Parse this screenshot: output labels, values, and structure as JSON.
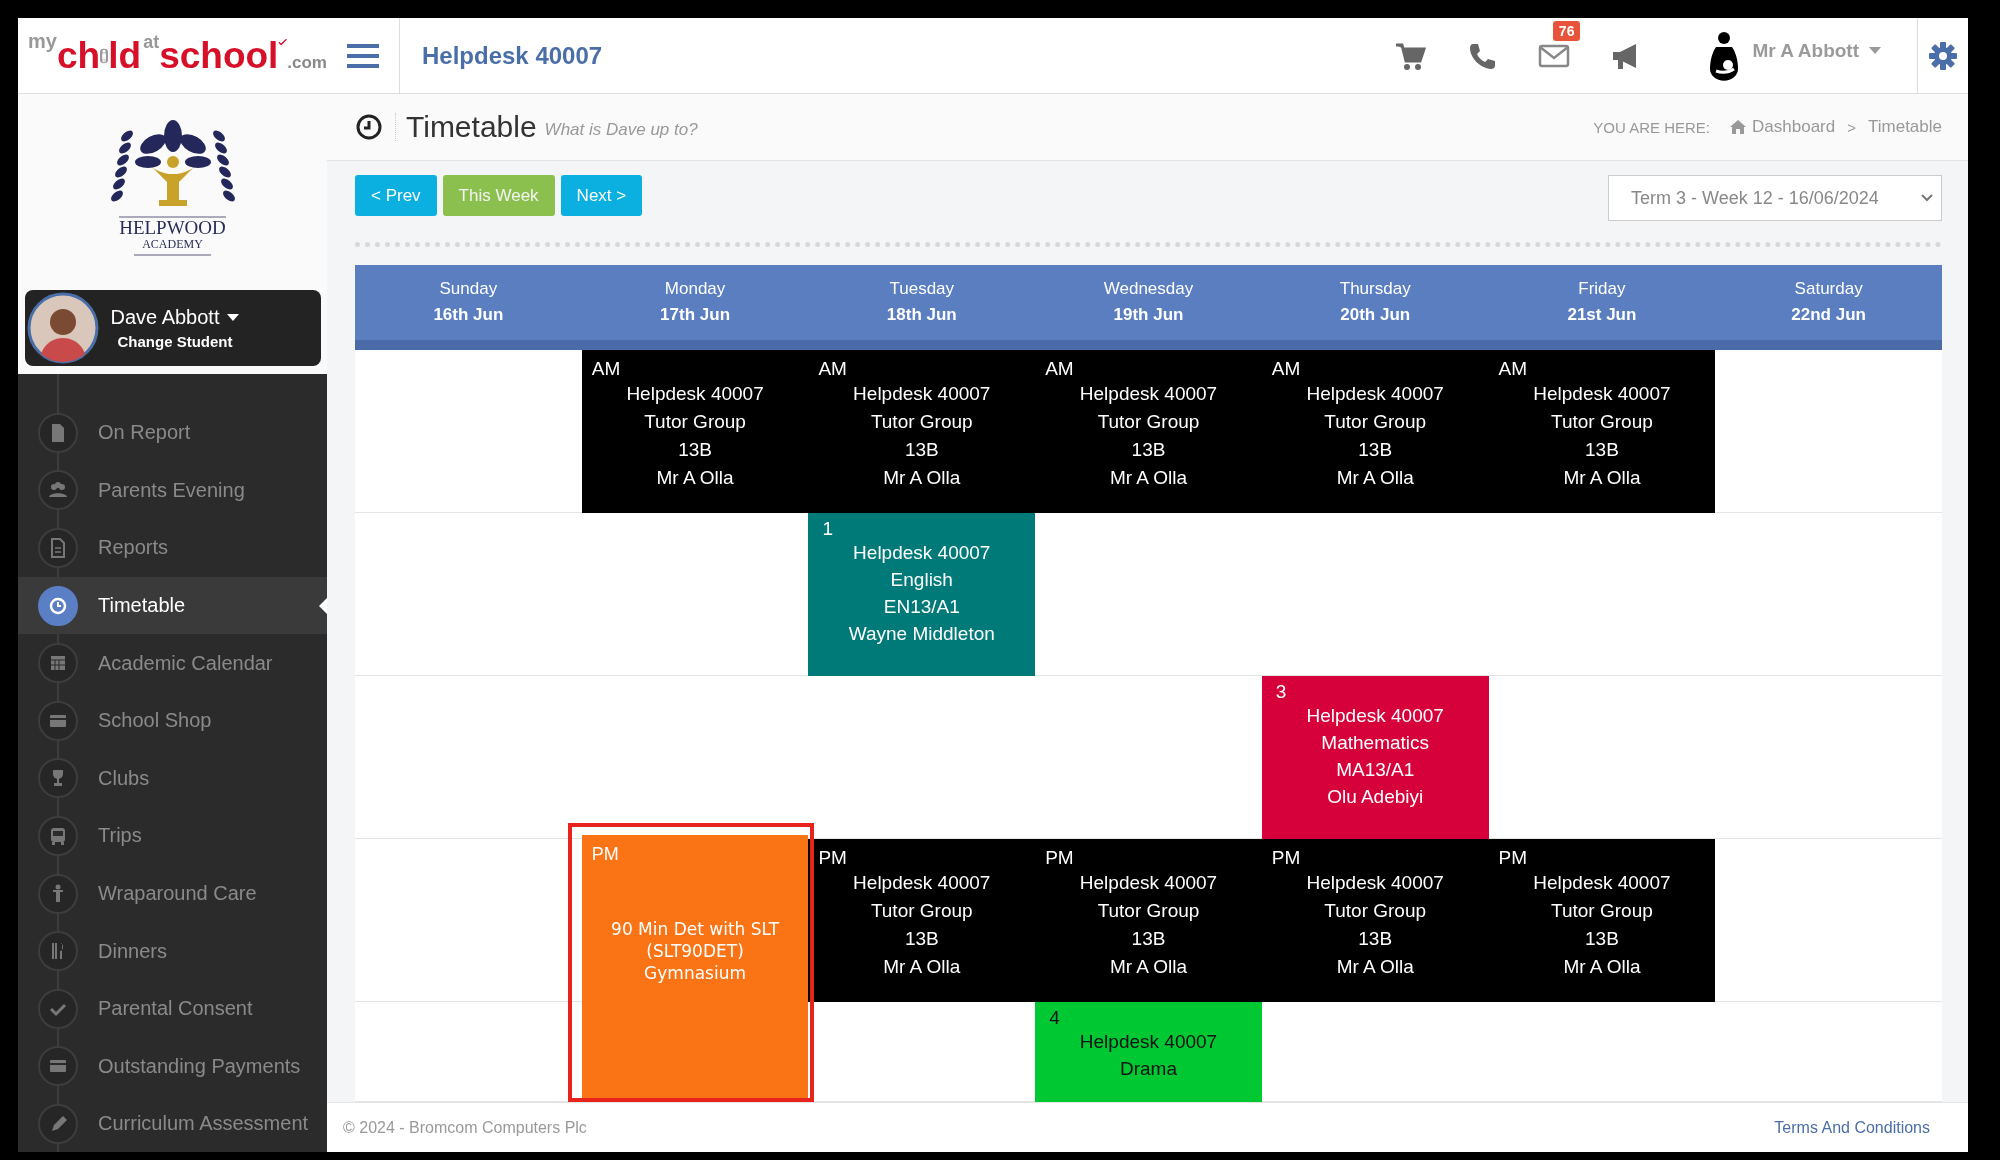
{
  "brand": {
    "prefix": "my",
    "part1": "ch",
    "part2": "ld",
    "at": "at",
    "part3": "school",
    "suffix": ".com"
  },
  "school": {
    "name": "HELPWOOD",
    "subtitle": "ACADEMY"
  },
  "student": {
    "name": "Dave Abbott",
    "action": "Change Student"
  },
  "sidebar": {
    "items": [
      {
        "label": "On Report",
        "selected": false
      },
      {
        "label": "Parents Evening",
        "selected": false
      },
      {
        "label": "Reports",
        "selected": false
      },
      {
        "label": "Timetable",
        "selected": true
      },
      {
        "label": "Academic Calendar",
        "selected": false
      },
      {
        "label": "School Shop",
        "selected": false
      },
      {
        "label": "Clubs",
        "selected": false
      },
      {
        "label": "Trips",
        "selected": false
      },
      {
        "label": "Wraparound Care",
        "selected": false
      },
      {
        "label": "Dinners",
        "selected": false
      },
      {
        "label": "Parental Consent",
        "selected": false
      },
      {
        "label": "Outstanding Payments",
        "selected": false
      },
      {
        "label": "Curriculum Assessment",
        "selected": false
      }
    ]
  },
  "topbar": {
    "title": "Helpdesk 40007",
    "mail_count": "76",
    "user": "Mr A Abbott"
  },
  "page": {
    "title": "Timetable",
    "subtitle": "What is Dave up to?",
    "breadcrumb_label": "YOU ARE HERE:",
    "breadcrumb": [
      "Dashboard",
      "Timetable"
    ],
    "separator": ">"
  },
  "week_nav": {
    "buttons": [
      {
        "label": "< Prev",
        "kind": "nav"
      },
      {
        "label": "This Week",
        "kind": "current"
      },
      {
        "label": "Next >",
        "kind": "nav"
      }
    ],
    "week_select": {
      "value": "Term 3 - Week 12 - 16/06/2024"
    }
  },
  "timetable": {
    "days": [
      {
        "day": "Sunday",
        "date": "16th Jun"
      },
      {
        "day": "Monday",
        "date": "17th Jun"
      },
      {
        "day": "Tuesday",
        "date": "18th Jun"
      },
      {
        "day": "Wednesday",
        "date": "19th Jun"
      },
      {
        "day": "Thursday",
        "date": "20th Jun"
      },
      {
        "day": "Friday",
        "date": "21st Jun"
      },
      {
        "day": "Saturday",
        "date": "22nd Jun"
      }
    ],
    "rows": [
      {
        "cells": [
          {
            "kind": "empty"
          },
          {
            "kind": "tutor",
            "period": "AM",
            "lines": [
              "Helpdesk 40007",
              "Tutor Group",
              "13B",
              "Mr A Olla"
            ],
            "color": "#000000"
          },
          {
            "kind": "tutor",
            "period": "AM",
            "lines": [
              "Helpdesk 40007",
              "Tutor Group",
              "13B",
              "Mr A Olla"
            ],
            "color": "#000000"
          },
          {
            "kind": "tutor",
            "period": "AM",
            "lines": [
              "Helpdesk 40007",
              "Tutor Group",
              "13B",
              "Mr A Olla"
            ],
            "color": "#000000"
          },
          {
            "kind": "tutor",
            "period": "AM",
            "lines": [
              "Helpdesk 40007",
              "Tutor Group",
              "13B",
              "Mr A Olla"
            ],
            "color": "#000000"
          },
          {
            "kind": "tutor",
            "period": "AM",
            "lines": [
              "Helpdesk 40007",
              "Tutor Group",
              "13B",
              "Mr A Olla"
            ],
            "color": "#000000"
          },
          {
            "kind": "empty"
          }
        ]
      },
      {
        "cells": [
          {
            "kind": "empty"
          },
          {
            "kind": "empty"
          },
          {
            "kind": "lesson",
            "period": "1",
            "lines": [
              "Helpdesk 40007",
              "English",
              "EN13/A1",
              "Wayne Middleton"
            ],
            "color": "#007a78"
          },
          {
            "kind": "empty"
          },
          {
            "kind": "empty"
          },
          {
            "kind": "empty"
          },
          {
            "kind": "empty"
          }
        ]
      },
      {
        "cells": [
          {
            "kind": "empty"
          },
          {
            "kind": "empty"
          },
          {
            "kind": "empty"
          },
          {
            "kind": "empty"
          },
          {
            "kind": "lesson",
            "period": "3",
            "lines": [
              "Helpdesk 40007",
              "Mathematics",
              "MA13/A1",
              "Olu Adebiyi"
            ],
            "color": "#d6003a"
          },
          {
            "kind": "empty"
          },
          {
            "kind": "empty"
          }
        ]
      },
      {
        "cells": [
          {
            "kind": "empty"
          },
          {
            "kind": "detention",
            "period": "PM",
            "lines": [
              "90 Min Det with SLT",
              "(SLT90DET)",
              "Gymnasium"
            ],
            "color": "#fa7314",
            "spans_next_row": true,
            "highlighted": true
          },
          {
            "kind": "tutor",
            "period": "PM",
            "lines": [
              "Helpdesk 40007",
              "Tutor Group",
              "13B",
              "Mr A Olla"
            ],
            "color": "#000000"
          },
          {
            "kind": "tutor",
            "period": "PM",
            "lines": [
              "Helpdesk 40007",
              "Tutor Group",
              "13B",
              "Mr A Olla"
            ],
            "color": "#000000"
          },
          {
            "kind": "tutor",
            "period": "PM",
            "lines": [
              "Helpdesk 40007",
              "Tutor Group",
              "13B",
              "Mr A Olla"
            ],
            "color": "#000000"
          },
          {
            "kind": "tutor",
            "period": "PM",
            "lines": [
              "Helpdesk 40007",
              "Tutor Group",
              "13B",
              "Mr A Olla"
            ],
            "color": "#000000"
          },
          {
            "kind": "empty"
          }
        ]
      },
      {
        "cells": [
          {
            "kind": "empty"
          },
          {
            "kind": "covered"
          },
          {
            "kind": "empty"
          },
          {
            "kind": "lesson",
            "period": "4",
            "lines": [
              "Helpdesk 40007",
              "Drama"
            ],
            "color": "#00c832",
            "dark_text": true
          },
          {
            "kind": "empty"
          },
          {
            "kind": "empty"
          },
          {
            "kind": "empty"
          }
        ]
      }
    ]
  },
  "footer": {
    "copyright": "© 2024 - Bromcom Computers Plc",
    "link": "Terms And Conditions"
  }
}
